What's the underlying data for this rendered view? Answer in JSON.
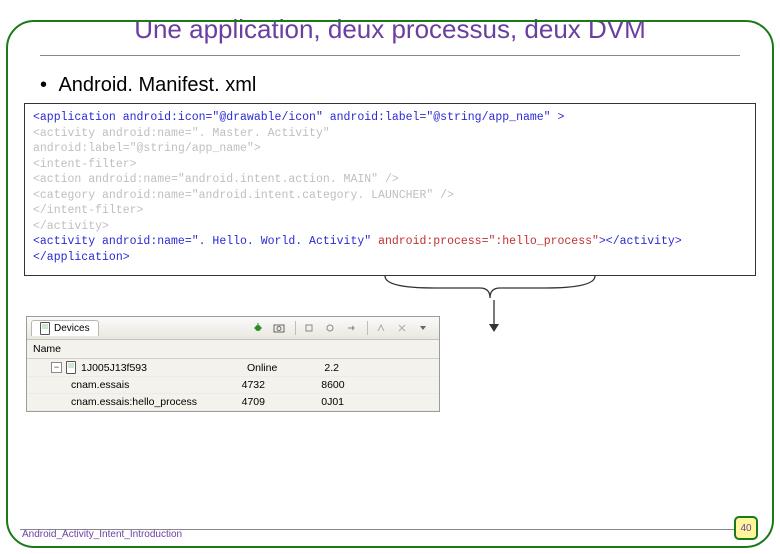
{
  "title": "Une application, deux processus, deux DVM",
  "bullet": "Android. Manifest. xml",
  "code": {
    "l1": "<application android:icon=\"@drawable/icon\" android:label=\"@string/app_name\" >",
    "l2": "    <activity android:name=\". Master. Activity\"",
    "l3": "              android:label=\"@string/app_name\">",
    "l4": "        <intent-filter>",
    "l5": "            <action android:name=\"android.intent.action. MAIN\" />",
    "l6": "            <category android:name=\"android.intent.category. LAUNCHER\" />",
    "l7": "        </intent-filter>",
    "l8": "",
    "l9": "    </activity>",
    "l10a": "    <activity android:name=\". Hello. World. Activity\" ",
    "l10b": "android:process=\":hello_process\"",
    "l10c": "></activity>",
    "l11": "</application>"
  },
  "panel": {
    "tab": "Devices",
    "header": "Name",
    "row1": {
      "name": "1J005J13f593",
      "status": "Online",
      "c1": "2.2",
      "c2": ""
    },
    "row2": {
      "name": "cnam.essais",
      "status": "4732",
      "c1": "8600",
      "c2": ""
    },
    "row3": {
      "name": "cnam.essais:hello_process",
      "status": "4709",
      "c1": "0J01",
      "c2": ""
    }
  },
  "footer": "Android_Activity_Intent_Introduction",
  "page": "40"
}
